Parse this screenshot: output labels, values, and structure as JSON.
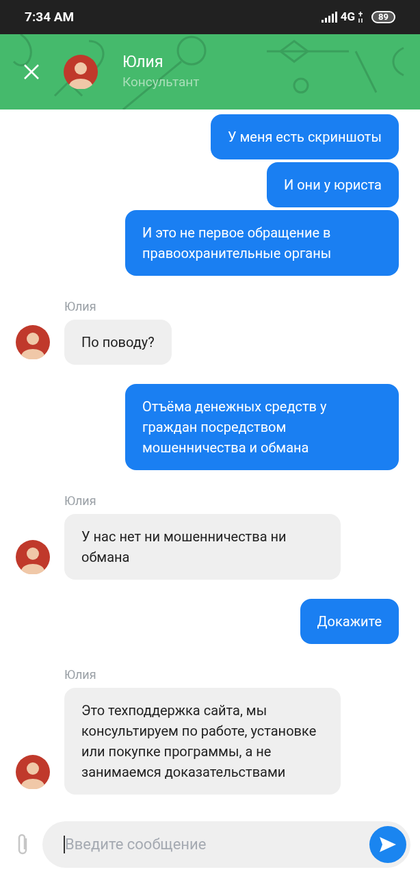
{
  "status_bar": {
    "time": "7:34 AM",
    "network": "4G",
    "battery": "89"
  },
  "header": {
    "name": "Юлия",
    "subtitle": "Консультант"
  },
  "messages": [
    {
      "kind": "outgoing",
      "text": "У меня есть скриншоты"
    },
    {
      "kind": "outgoing",
      "text": "И они у юриста"
    },
    {
      "kind": "outgoing",
      "text": "И это не первое обращение в правоохранительные органы"
    },
    {
      "kind": "incoming",
      "sender": "Юлия",
      "text": "По поводу?"
    },
    {
      "kind": "outgoing",
      "text": "Отъёма денежных средств у граждан посредством мошенничества и обмана"
    },
    {
      "kind": "incoming",
      "sender": "Юлия",
      "text": "У нас нет ни мошенничества ни обмана"
    },
    {
      "kind": "outgoing",
      "text": "Докажите"
    },
    {
      "kind": "incoming",
      "sender": "Юлия",
      "text": "Это техподдержка сайта, мы консультируем по работе, установке или покупке программы, а не занимаемся доказательствами"
    }
  ],
  "composer": {
    "placeholder": "Введите сообщение"
  }
}
